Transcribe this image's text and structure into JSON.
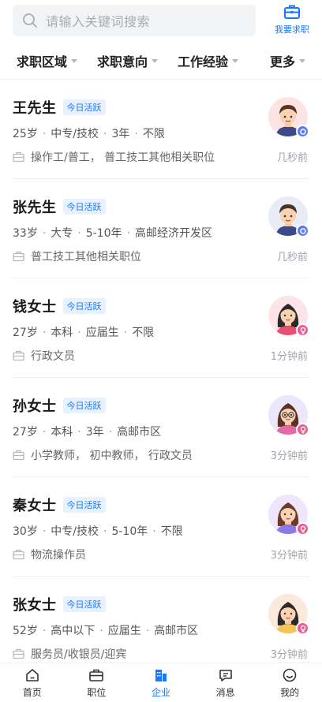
{
  "search": {
    "placeholder": "请输入关键词搜索",
    "icon": "search-icon"
  },
  "job_button": {
    "label": "我要求职",
    "icon": "briefcase-icon"
  },
  "filters": [
    {
      "label": "求职区域"
    },
    {
      "label": "求职意向"
    },
    {
      "label": "工作经验"
    },
    {
      "label": "更多"
    }
  ],
  "candidates": [
    {
      "name": "王先生",
      "badge": "今日活跃",
      "age": "25岁",
      "education": "中专/技校",
      "experience": "3年",
      "area": "不限",
      "intent": "操作工/普工， 普工技工其他相关职位",
      "time": "几秒前",
      "gender": "male"
    },
    {
      "name": "张先生",
      "badge": "今日活跃",
      "age": "33岁",
      "education": "大专",
      "experience": "5-10年",
      "area": "高邮经济开发区",
      "intent": "普工技工其他相关职位",
      "time": "几秒前",
      "gender": "male"
    },
    {
      "name": "钱女士",
      "badge": "今日活跃",
      "age": "27岁",
      "education": "本科",
      "experience": "应届生",
      "area": "不限",
      "intent": "行政文员",
      "time": "1分钟前",
      "gender": "female"
    },
    {
      "name": "孙女士",
      "badge": "今日活跃",
      "age": "27岁",
      "education": "本科",
      "experience": "3年",
      "area": "高邮市区",
      "intent": "小学教师， 初中教师， 行政文员",
      "time": "3分钟前",
      "gender": "female"
    },
    {
      "name": "秦女士",
      "badge": "今日活跃",
      "age": "30岁",
      "education": "中专/技校",
      "experience": "5-10年",
      "area": "不限",
      "intent": "物流操作员",
      "time": "3分钟前",
      "gender": "female"
    },
    {
      "name": "张女士",
      "badge": "今日活跃",
      "age": "52岁",
      "education": "高中以下",
      "experience": "应届生",
      "area": "高邮市区",
      "intent": "服务员/收银员/迎宾",
      "time": "3分钟前",
      "gender": "female"
    }
  ],
  "tabs": [
    {
      "label": "首页",
      "icon": "home-icon"
    },
    {
      "label": "职位",
      "icon": "briefcase-icon"
    },
    {
      "label": "企业",
      "icon": "building-icon"
    },
    {
      "label": "消息",
      "icon": "message-icon"
    },
    {
      "label": "我的",
      "icon": "profile-icon"
    }
  ],
  "colors": {
    "accent": "#1677ff",
    "badge_bg": "#e8f2ff",
    "male": "#5b7cf7",
    "female": "#ee5a8f"
  }
}
